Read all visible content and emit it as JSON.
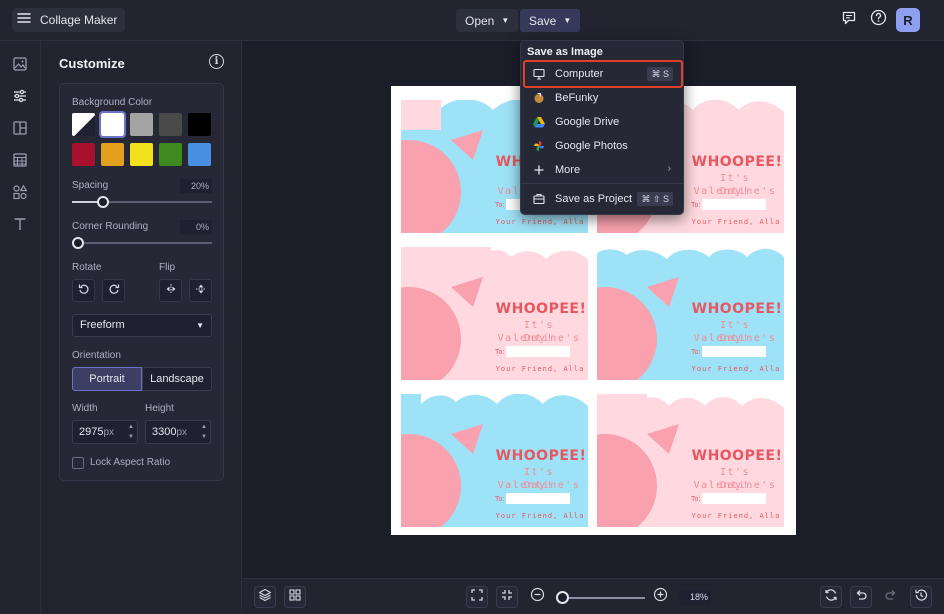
{
  "header": {
    "app_title": "Collage Maker",
    "open_label": "Open",
    "save_label": "Save",
    "avatar_initial": "R"
  },
  "rail": {
    "icons": [
      "image-icon",
      "sliders-icon",
      "layout-icon",
      "texture-icon",
      "shapes-icon",
      "text-icon"
    ]
  },
  "panel": {
    "title": "Customize",
    "background_color_label": "Background Color",
    "swatches": [
      "transparent",
      "#ffffff",
      "#a3a3a3",
      "#4a4a4a",
      "#000000",
      "#a8112e",
      "#e3a01f",
      "#f3e11d",
      "#3f8a1f",
      "#4a90e2"
    ],
    "spacing_label": "Spacing",
    "spacing_value": "20%",
    "spacing_level": 0.2,
    "corner_rounding_label": "Corner Rounding",
    "corner_rounding_value": "0%",
    "corner_rounding_level": 0,
    "rotate_label": "Rotate",
    "flip_label": "Flip",
    "layout_select": "Freeform",
    "orientation_label": "Orientation",
    "portrait_label": "Portrait",
    "landscape_label": "Landscape",
    "width_label": "Width",
    "height_label": "Height",
    "width_value": "2975",
    "height_value": "3300",
    "unit": "px",
    "lock_aspect_label": "Lock Aspect Ratio"
  },
  "card_text": {
    "headline": "WHOOPEE!",
    "line1": "It's Valentine's",
    "line2": "Day!",
    "to_label": "To:",
    "from": "Your Friend, Alla"
  },
  "bottombar": {
    "zoom_value": "18%",
    "zoom_level": 0.18
  },
  "save_menu": {
    "header": "Save as Image",
    "items": [
      {
        "label": "Computer",
        "shortcut": "⌘ S",
        "icon": "monitor-icon"
      },
      {
        "label": "BeFunky",
        "icon": "befunky-icon"
      },
      {
        "label": "Google Drive",
        "icon": "google-drive-icon"
      },
      {
        "label": "Google Photos",
        "icon": "google-photos-icon"
      },
      {
        "label": "More",
        "icon": "plus-icon"
      },
      {
        "label": "Save as Project",
        "shortcut": "⌘ ⇧ S",
        "icon": "project-icon"
      }
    ]
  },
  "colors": {
    "accent": "#6d74c7",
    "highlight": "#e0402a",
    "card_pink": "#f9a1ae",
    "card_blue": "#9ee2f7"
  }
}
